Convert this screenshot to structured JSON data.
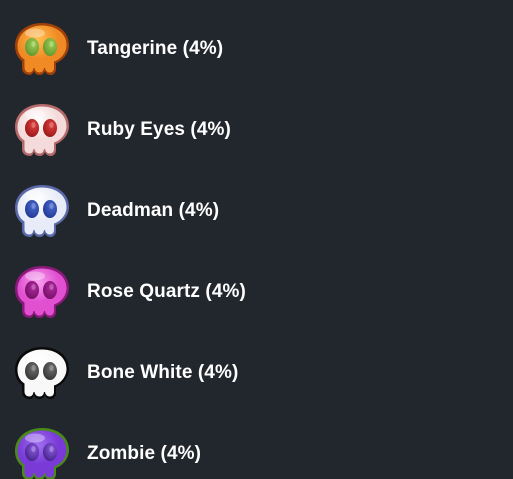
{
  "skins": [
    {
      "label": "Tangerine (4%)",
      "icon": "tangerine-skull-icon",
      "colors": {
        "outline": "#a0410a",
        "base": "#f08a25",
        "highlight": "#ffc050",
        "eye": "#5a8a2a",
        "eye_hi": "#9ad050"
      }
    },
    {
      "label": "Ruby Eyes (4%)",
      "icon": "ruby-eyes-skull-icon",
      "colors": {
        "outline": "#b46a6a",
        "base": "#f4dada",
        "highlight": "#ffffff",
        "eye": "#8c1010",
        "eye_hi": "#e04040"
      }
    },
    {
      "label": "Deadman (4%)",
      "icon": "deadman-skull-icon",
      "colors": {
        "outline": "#5a6aa8",
        "base": "#e8ecf8",
        "highlight": "#ffffff",
        "eye": "#1a2e8a",
        "eye_hi": "#4a6ad0"
      }
    },
    {
      "label": "Rose Quartz (4%)",
      "icon": "rose-quartz-skull-icon",
      "colors": {
        "outline": "#8a1a7a",
        "base": "#e050d0",
        "highlight": "#f8a0f0",
        "eye": "#6a0a5a",
        "eye_hi": "#b02aa0"
      }
    },
    {
      "label": "Bone White (4%)",
      "icon": "bone-white-skull-icon",
      "colors": {
        "outline": "#0a0a0a",
        "base": "#f8f8f8",
        "highlight": "#ffffff",
        "eye": "#2a2a2a",
        "eye_hi": "#707070"
      }
    },
    {
      "label": "Zombie (4%)",
      "icon": "zombie-skull-icon",
      "colors": {
        "outline": "#4a8a1a",
        "base": "#7a3ad8",
        "highlight": "#a070f0",
        "eye": "#3a1a7a",
        "eye_hi": "#8a5ae0"
      }
    }
  ]
}
